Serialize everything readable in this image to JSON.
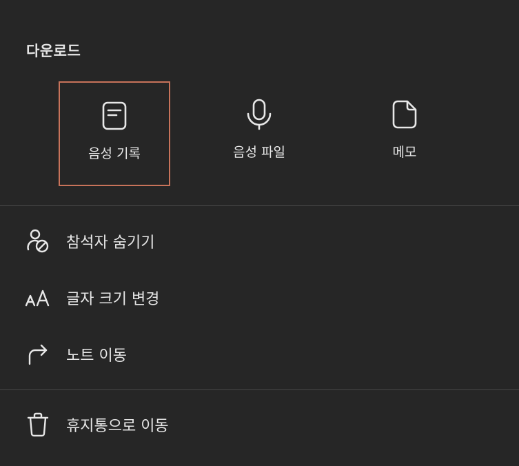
{
  "download": {
    "title": "다운로드",
    "options": [
      {
        "label": "음성 기록",
        "icon": "transcript-icon",
        "selected": true
      },
      {
        "label": "음성 파일",
        "icon": "microphone-icon",
        "selected": false
      },
      {
        "label": "메모",
        "icon": "document-icon",
        "selected": false
      }
    ]
  },
  "menu": {
    "items": [
      {
        "label": "참석자 숨기기",
        "icon": "hide-participant-icon"
      },
      {
        "label": "글자 크기 변경",
        "icon": "font-size-icon"
      },
      {
        "label": "노트 이동",
        "icon": "move-arrow-icon"
      },
      {
        "label": "휴지통으로 이동",
        "icon": "trash-icon"
      }
    ]
  },
  "colors": {
    "background": "#262626",
    "text": "#e6e6e6",
    "selected_border": "#c8735a",
    "divider": "#484848"
  }
}
